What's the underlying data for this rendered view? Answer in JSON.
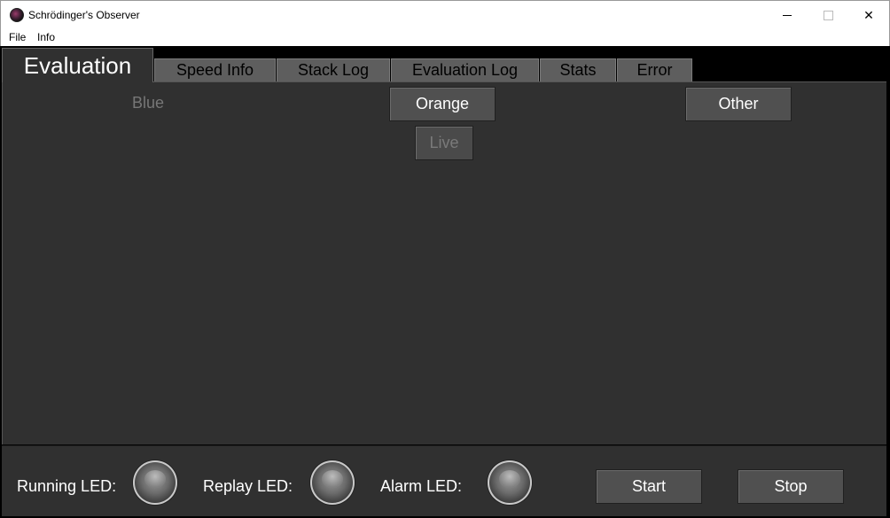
{
  "window": {
    "title": "Schrödinger's Observer",
    "icon": "app-logo-icon",
    "controls": {
      "minimize": "minimize-icon",
      "maximize": "maximize-icon",
      "close": "✕"
    }
  },
  "menu": {
    "items": [
      "File",
      "Info"
    ]
  },
  "tabs": [
    {
      "label": "Evaluation",
      "active": true
    },
    {
      "label": "Speed Info",
      "active": false
    },
    {
      "label": "Stack Log",
      "active": false
    },
    {
      "label": "Evaluation Log",
      "active": false
    },
    {
      "label": "Stats",
      "active": false
    },
    {
      "label": "Error",
      "active": false
    }
  ],
  "evaluation": {
    "blue_label": "Blue",
    "orange_button": "Orange",
    "live_button": "Live",
    "other_button": "Other"
  },
  "status": {
    "running_label": "Running LED:",
    "replay_label": "Replay LED:",
    "alarm_label": "Alarm LED:"
  },
  "actions": {
    "start": "Start",
    "stop": "Stop"
  },
  "colors": {
    "panel": "#303030",
    "button": "#505050",
    "tab_inactive": "#5e5e5e",
    "background": "#000000"
  }
}
